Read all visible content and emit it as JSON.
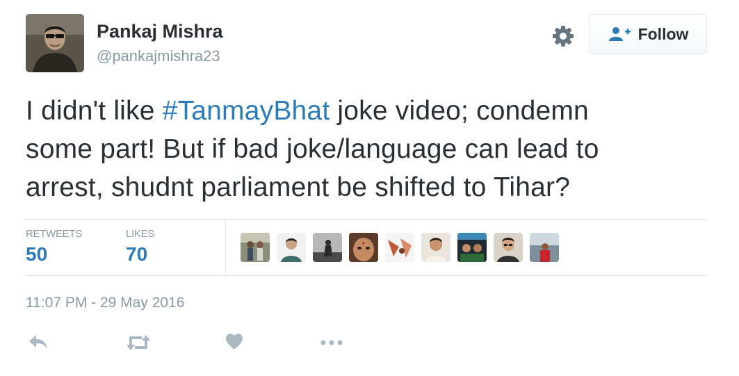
{
  "user": {
    "display_name": "Pankaj Mishra",
    "handle": "@pankajmishra23",
    "avatar_icon": "profile-photo"
  },
  "header": {
    "settings_icon": "gear-icon",
    "follow_label": "Follow",
    "follow_icon": "add-user-icon"
  },
  "tweet": {
    "lines": [
      {
        "before": "I didn't like ",
        "hashtag": "#TanmayBhat",
        "after": " joke video; condemn"
      },
      {
        "text": "some part! But if bad joke/language can lead to"
      },
      {
        "text": "arrest, shudnt parliament be shifted to Tihar?"
      }
    ]
  },
  "stats": {
    "retweets_label": "RETWEETS",
    "retweets_value": "50",
    "likes_label": "LIKES",
    "likes_value": "70"
  },
  "likers_count_shown": 9,
  "timestamp": "11:07 PM - 29 May 2016",
  "actions": [
    "reply-icon",
    "retweet-icon",
    "like-icon",
    "more-icon"
  ],
  "colors": {
    "link": "#2b7bb9",
    "muted": "#8899a6",
    "text": "#292f33",
    "action_icon": "#aab8c2",
    "follow_icon": "#2b7bb9"
  }
}
